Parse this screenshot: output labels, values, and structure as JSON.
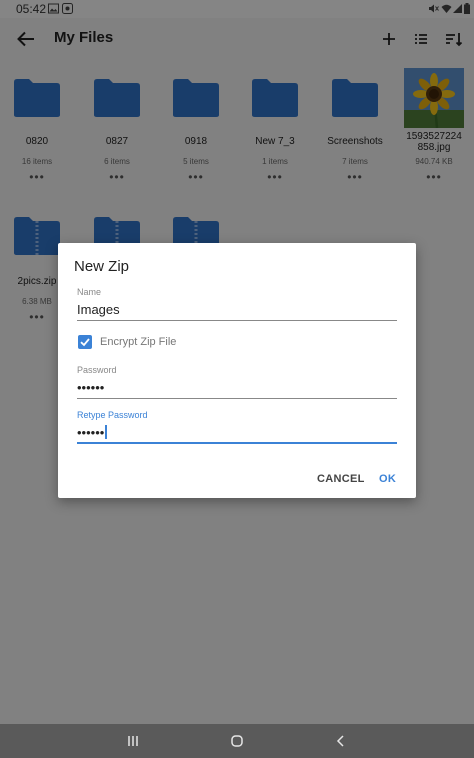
{
  "status_bar": {
    "time": "05:42"
  },
  "app_bar": {
    "title": "My Files"
  },
  "files": [
    {
      "type": "folder",
      "name": "0820",
      "meta": "16 items"
    },
    {
      "type": "folder",
      "name": "0827",
      "meta": "6 items"
    },
    {
      "type": "folder",
      "name": "0918",
      "meta": "5 items"
    },
    {
      "type": "folder",
      "name": "New 7_3",
      "meta": "1 items"
    },
    {
      "type": "folder",
      "name": "Screenshots",
      "meta": "7 items"
    },
    {
      "type": "image",
      "name": "1593527224858.jpg",
      "name_line1": "1593527224",
      "name_line2": "858.jpg",
      "meta": "940.74 KB"
    },
    {
      "type": "zip",
      "name": "2pics.zip",
      "meta": "6.38 MB"
    }
  ],
  "more_glyph": "•••",
  "dialog": {
    "title": "New Zip",
    "name_label": "Name",
    "name_value": "Images",
    "encrypt_label": "Encrypt Zip File",
    "encrypt_checked": true,
    "password_label": "Password",
    "password_value": "••••••",
    "retype_label": "Retype Password",
    "retype_value": "••••••",
    "cancel": "CANCEL",
    "ok": "OK"
  },
  "colors": {
    "accent": "#3b82d6",
    "folder": "#2f6fc2",
    "scrim": "rgba(0,0,0,0.45)"
  },
  "icons": [
    "back-arrow-icon",
    "add-icon",
    "list-view-icon",
    "sort-icon",
    "image-icon",
    "mute-icon",
    "wifi-icon",
    "signal-icon",
    "battery-icon",
    "recents-icon",
    "home-icon",
    "nav-back-icon"
  ]
}
